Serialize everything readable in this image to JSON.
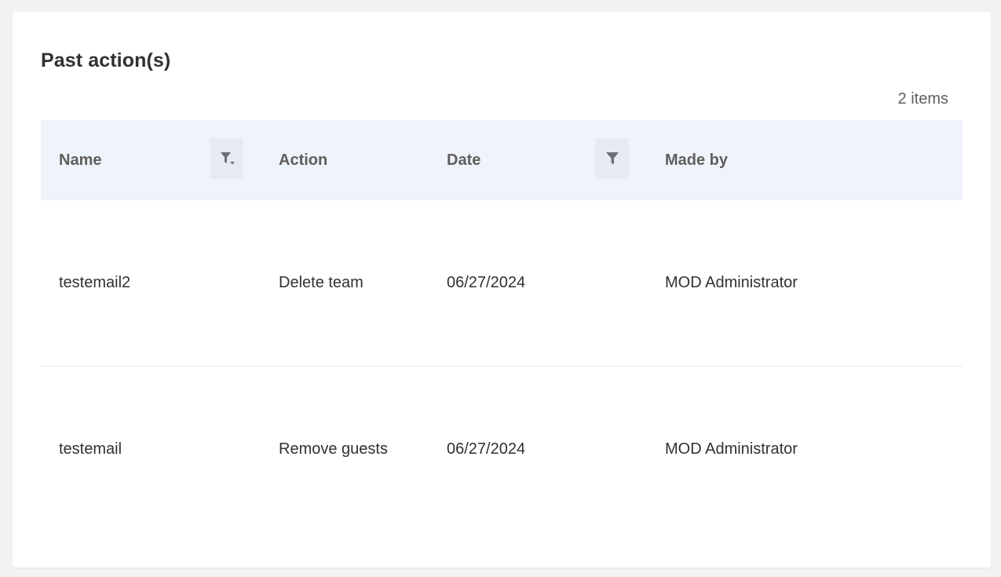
{
  "panel": {
    "title": "Past action(s)",
    "item_count": "2 items"
  },
  "table": {
    "columns": {
      "name": "Name",
      "action": "Action",
      "date": "Date",
      "made_by": "Made by"
    },
    "icons": {
      "name_filter": "filter-sort-icon",
      "date_filter": "filter-icon"
    },
    "rows": [
      {
        "name": "testemail2",
        "action": "Delete team",
        "date": "06/27/2024",
        "made_by": "MOD Administrator"
      },
      {
        "name": "testemail",
        "action": "Remove guests",
        "date": "06/27/2024",
        "made_by": "MOD Administrator"
      }
    ]
  },
  "colors": {
    "page_background": "#f2f2f2",
    "card_background": "#ffffff",
    "header_background": "#eff3fa",
    "filter_button_background": "#e6ebf3",
    "header_text": "#605e5c",
    "body_text": "#323130"
  }
}
